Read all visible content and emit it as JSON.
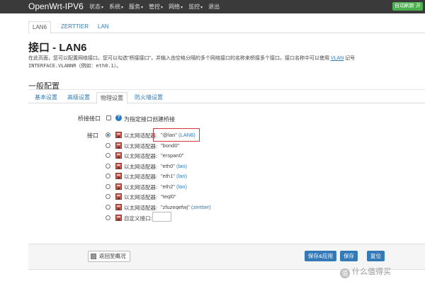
{
  "navbar": {
    "brand": "OpenWrt-IPV6",
    "menu": [
      "状态",
      "系统",
      "服务",
      "管控",
      "网络",
      "监控"
    ],
    "logout": "退出",
    "refresh_badge": "自动刷新 开"
  },
  "top_tabs": [
    "LAN6",
    "ZERTTIER",
    "LAN"
  ],
  "page": {
    "title": "接口 - LAN6",
    "desc_part1": "在此页面，您可以配置网络接口。您可以勾选\"桥接接口\"，并输入由空格分隔的多个网络接口的名称来桥接多个接口。接口名称中可以使用",
    "desc_link": "VLAN",
    "desc_part2": "记号",
    "desc_line2": "INTERFACE.VLANNR（例如：eth0.1）。"
  },
  "section_title": "一般配置",
  "sub_tabs": [
    "基本设置",
    "高级设置",
    "物理设置",
    "防火墙设置"
  ],
  "form": {
    "bridge_label": "桥接接口",
    "bridge_help": "?",
    "bridge_text": "为指定接口创建桥接",
    "interface_label": "接口",
    "prefix": "以太网适配器:",
    "options": [
      {
        "name": "\"@lan\"",
        "network": "(LAN6)",
        "checked": true
      },
      {
        "name": "\"bond0\"",
        "network": ""
      },
      {
        "name": "\"erspan0\"",
        "network": ""
      },
      {
        "name": "\"eth0\"",
        "network": "(lan)"
      },
      {
        "name": "\"eth1\"",
        "network": "(lan)"
      },
      {
        "name": "\"eth2\"",
        "network": "(lan)"
      },
      {
        "name": "\"teql0\"",
        "network": ""
      },
      {
        "name": "\"zfuzeqefwj\"",
        "network": "(zerttier)"
      }
    ],
    "custom_label": "自定义接口:",
    "custom_value": ""
  },
  "footer": {
    "back_label": "返回至概况",
    "save_apply_label": "保存&应用",
    "save_label": "保存",
    "reset_label": "复位"
  },
  "watermark": {
    "logo": "值",
    "text": "什么值得买"
  },
  "colors": {
    "accent": "#337ab7",
    "navbar": "#3a3a3a",
    "highlight": "#d4393e",
    "badge": "#4caf50"
  }
}
